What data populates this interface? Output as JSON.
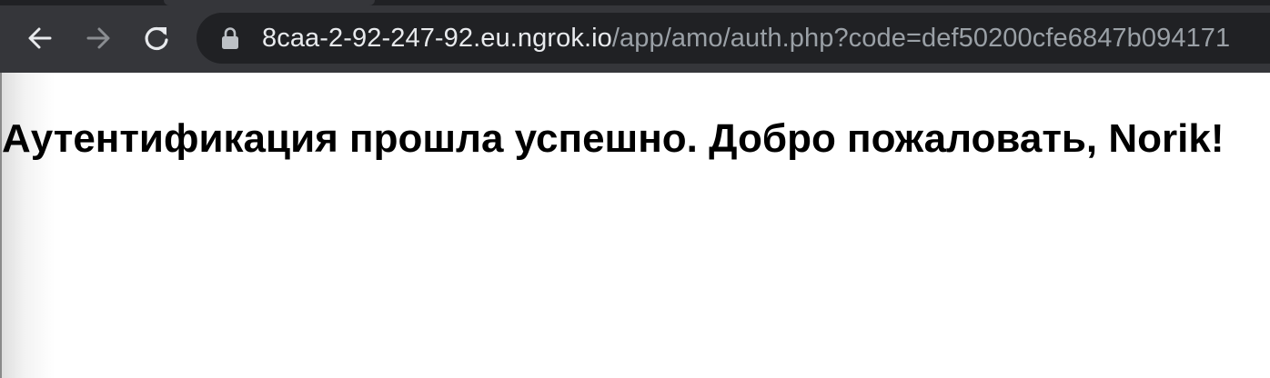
{
  "browser": {
    "nav": {
      "back_icon": "arrow-left-icon",
      "forward_icon": "arrow-right-icon",
      "reload_icon": "reload-icon"
    },
    "address_bar": {
      "lock_icon": "lock-icon",
      "url_host": "8caa-2-92-247-92.eu.ngrok.io",
      "url_path": "/app/amo/auth.php?code=def50200cfe6847b094171"
    }
  },
  "page": {
    "heading": "Аутентификация прошла успешно. Добро пожаловать, Norik!"
  },
  "colors": {
    "toolbar_bg": "#35363a",
    "omnibox_bg": "#202124",
    "url_host": "#e8eaed",
    "url_path": "#9aa0a6",
    "page_bg": "#ffffff",
    "text": "#000000"
  }
}
